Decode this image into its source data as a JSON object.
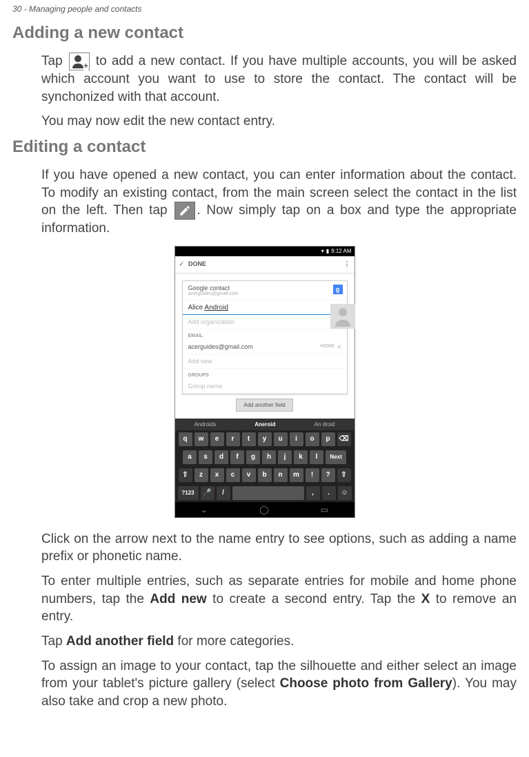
{
  "header": {
    "page_number": "30",
    "chapter": "Managing people and contacts"
  },
  "sections": {
    "adding": {
      "title": "Adding a new contact",
      "p1a": "Tap ",
      "p1b": " to add a new contact. If you have multiple accounts, you will be asked which account you want to use to store the contact. The contact will be synchonized with that account.",
      "p2": "You may now edit the new contact entry."
    },
    "editing": {
      "title": "Editing a contact",
      "p1a": "If you have opened a new contact, you can enter information about the contact. To modify an existing contact, from the main screen select the contact in the  list on the left. Then tap ",
      "p1b": ". Now simply tap on a box and type the appropriate information.",
      "p2": "Click on the arrow next to the name entry to see options, such as adding a name prefix or phonetic name.",
      "p3a": "To enter multiple entries, such as separate entries for mobile and home phone numbers, tap the ",
      "p3_bold1": "Add new",
      "p3b": " to create a second entry. Tap the ",
      "p3_bold2": "X",
      "p3c": " to remove an entry.",
      "p4a": "Tap ",
      "p4_bold": "Add another field",
      "p4b": " for more categories.",
      "p5a": "To assign an image to your contact, tap the silhouette and either select an image from your tablet's picture gallery (select ",
      "p5_bold": "Choose photo from Gallery",
      "p5b": "). You may also take and crop a new photo."
    }
  },
  "screenshot": {
    "status_time": "9:12 AM",
    "done_label": "DONE",
    "account_type": "Google contact",
    "account_email": "acerguides@gmail.com",
    "google_g": "g",
    "name_first": "Alice ",
    "name_last": "Android",
    "add_org": "Add organization",
    "email_label": "EMAIL",
    "email_value": "acerguides@gmail.com",
    "email_type": "HOME",
    "email_x": "×",
    "add_new": "Add new",
    "groups_label": "GROUPS",
    "group_name": "Group name",
    "add_field_btn": "Add another field",
    "suggestions": {
      "s1": "Androids",
      "s2": "Aneroid",
      "s3": "An droid"
    },
    "kb_row1": [
      "q",
      "w",
      "e",
      "r",
      "t",
      "y",
      "u",
      "i",
      "o",
      "p",
      "⌫"
    ],
    "kb_row2": [
      "a",
      "s",
      "d",
      "f",
      "g",
      "h",
      "j",
      "k",
      "l",
      "Next"
    ],
    "kb_row3": [
      "⇧",
      "z",
      "x",
      "c",
      "v",
      "b",
      "n",
      "m",
      "!",
      "?",
      "⇧"
    ],
    "kb_row4": [
      "?123",
      "🎤",
      "/",
      "",
      ",",
      ".",
      "☺"
    ],
    "nav": {
      "back": "⌄",
      "home": "◯",
      "recent": "▭"
    }
  }
}
